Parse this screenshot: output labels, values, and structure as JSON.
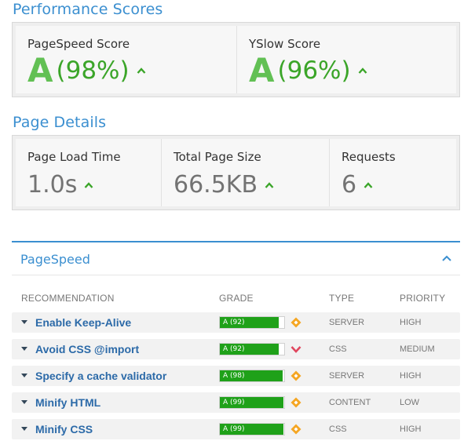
{
  "performance": {
    "title": "Performance Scores",
    "pagespeed": {
      "label": "PageSpeed Score",
      "grade": "A",
      "percent": "(98%)"
    },
    "yslow": {
      "label": "YSlow Score",
      "grade": "A",
      "percent": "(96%)"
    }
  },
  "details": {
    "title": "Page Details",
    "load_time": {
      "label": "Page Load Time",
      "value": "1.0s"
    },
    "page_size": {
      "label": "Total Page Size",
      "value": "66.5KB"
    },
    "requests": {
      "label": "Requests",
      "value": "6"
    }
  },
  "pagespeed_panel": {
    "title": "PageSpeed",
    "columns": {
      "recommendation": "RECOMMENDATION",
      "grade": "GRADE",
      "type": "TYPE",
      "priority": "PRIORITY"
    },
    "rows": [
      {
        "recommendation": "Enable Keep-Alive",
        "grade": "A (92)",
        "score": 92,
        "priority_icon": "diamond-icon",
        "type": "SERVER",
        "priority": "HIGH"
      },
      {
        "recommendation": "Avoid CSS @import",
        "grade": "A (92)",
        "score": 92,
        "priority_icon": "chevron-down-icon",
        "type": "CSS",
        "priority": "MEDIUM"
      },
      {
        "recommendation": "Specify a cache validator",
        "grade": "A (98)",
        "score": 98,
        "priority_icon": "diamond-icon",
        "type": "SERVER",
        "priority": "HIGH"
      },
      {
        "recommendation": "Minify HTML",
        "grade": "A (99)",
        "score": 99,
        "priority_icon": "diamond-icon",
        "type": "CONTENT",
        "priority": "LOW"
      },
      {
        "recommendation": "Minify CSS",
        "grade": "A (99)",
        "score": 99,
        "priority_icon": "diamond-icon",
        "type": "CSS",
        "priority": "HIGH"
      }
    ]
  },
  "colors": {
    "accent": "#3b8fd0",
    "grade_green": "#62c054",
    "bar_green": "#1fa119",
    "high_priority": "#f5a623",
    "medium_priority": "#e0465e"
  }
}
